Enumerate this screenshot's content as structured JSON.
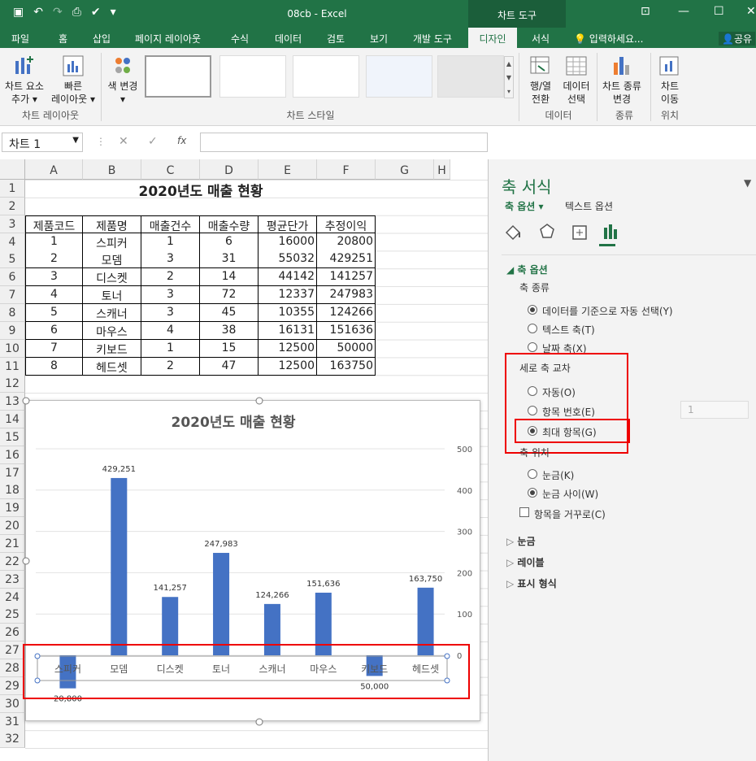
{
  "window": {
    "title": "08cb - Excel",
    "context_tab": "차트 도구"
  },
  "tabs": [
    "파일",
    "홈",
    "삽입",
    "페이지 레이아웃",
    "수식",
    "데이터",
    "검토",
    "보기",
    "개발 도구",
    "디자인",
    "서식"
  ],
  "tell_me": "입력하세요...",
  "share": "공유",
  "ribbon": {
    "add_element": "차트 요소\n추가 ▾",
    "quick_layout": "빠른\n레이아웃 ▾",
    "change_color": "색 변경\n▾",
    "group_layout": "차트 레이아웃",
    "group_styles": "차트 스타일",
    "switch_rowcol": "행/열\n전환",
    "select_data": "데이터\n선택",
    "group_data": "데이터",
    "change_type": "차트 종류\n변경",
    "group_type": "종류",
    "move_chart": "차트\n이동",
    "group_location": "위치"
  },
  "name_box": "차트 1",
  "fx": "fx",
  "columns": [
    "A",
    "B",
    "C",
    "D",
    "E",
    "F",
    "G",
    "H"
  ],
  "rows": [
    "1",
    "2",
    "3",
    "4",
    "5",
    "6",
    "7",
    "8",
    "9",
    "10",
    "11",
    "12",
    "13",
    "14",
    "15",
    "16",
    "17",
    "18",
    "19",
    "20",
    "21",
    "22",
    "23",
    "24",
    "25",
    "26",
    "27",
    "28",
    "29",
    "30",
    "31",
    "32"
  ],
  "sheet": {
    "title": "2020년도 매출 현황",
    "headers": [
      "제품코드",
      "제품명",
      "매출건수",
      "매출수량",
      "평균단가",
      "추정이익"
    ],
    "data": [
      [
        "1",
        "스피커",
        "1",
        "6",
        "16000",
        "20800"
      ],
      [
        "2",
        "모뎀",
        "3",
        "31",
        "55032",
        "429251"
      ],
      [
        "3",
        "디스켓",
        "2",
        "14",
        "44142",
        "141257"
      ],
      [
        "4",
        "토너",
        "3",
        "72",
        "12337",
        "247983"
      ],
      [
        "5",
        "스캐너",
        "3",
        "45",
        "10355",
        "124266"
      ],
      [
        "6",
        "마우스",
        "4",
        "38",
        "16131",
        "151636"
      ],
      [
        "7",
        "키보드",
        "1",
        "15",
        "12500",
        "50000"
      ],
      [
        "8",
        "헤드셋",
        "2",
        "47",
        "12500",
        "163750"
      ]
    ]
  },
  "chart_data": {
    "type": "bar",
    "title": "2020년도 매출 현황",
    "categories": [
      "스피커",
      "모뎀",
      "디스켓",
      "토너",
      "스캐너",
      "마우스",
      "키보드",
      "헤드셋"
    ],
    "values": [
      -80000,
      429251,
      141257,
      247983,
      124266,
      151636,
      -50000,
      163750
    ],
    "data_labels": [
      "20,800",
      "429,251",
      "141,257",
      "247,983",
      "124,266",
      "151,636",
      "50,000",
      "163,750"
    ],
    "y_ticks": [
      "500",
      "400",
      "300",
      "200",
      "100",
      "0"
    ],
    "color": "#4472c4"
  },
  "pane": {
    "title": "축 서식",
    "tab_axis": "축 옵션 ▾",
    "tab_text": "텍스트 옵션",
    "section": "축 옵션",
    "axis_type": "축 종류",
    "opt_auto": "데이터를 기준으로 자동 선택(Y)",
    "opt_text": "텍스트 축(T)",
    "opt_date": "날짜 축(X)",
    "cross": "세로 축 교차",
    "cross_auto": "자동(O)",
    "cross_num": "항목 번호(E)",
    "cross_num_val": "1",
    "cross_max": "최대 항목(G)",
    "pos": "축 위치",
    "pos_on": "눈금(K)",
    "pos_between": "눈금 사이(W)",
    "reverse": "항목을 거꾸로(C)",
    "ticks": "눈금",
    "labels": "레이블",
    "number": "표시 형식"
  }
}
